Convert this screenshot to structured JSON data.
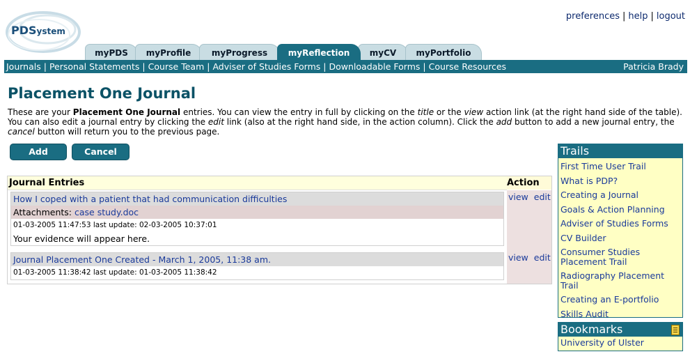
{
  "logo": {
    "text_part1": "PDS",
    "text_part2": "ystem"
  },
  "top_links": {
    "preferences": "preferences",
    "help": "help",
    "logout": "logout",
    "separator": "|"
  },
  "tabs": [
    {
      "label": "myPDS"
    },
    {
      "label": "myProfile"
    },
    {
      "label": "myProgress"
    },
    {
      "label": "myReflection"
    },
    {
      "label": "myCV"
    },
    {
      "label": "myPortfolio"
    }
  ],
  "navbar": {
    "items": [
      "Journals",
      "Personal Statements",
      "Course Team",
      "Adviser of Studies Forms",
      "Downloadable Forms",
      "Course Resources"
    ],
    "separator": "|",
    "user": "Patricia Brady"
  },
  "page": {
    "title": "Placement One Journal",
    "intro_1": "These are your ",
    "intro_bold": "Placement One Journal",
    "intro_2": " entries. You can view the entry in full by clicking on the ",
    "intro_title": "title",
    "intro_3": " or the ",
    "intro_view": "view",
    "intro_4": " action link (at the right hand side of the table). You can also edit a journal entry by clicking the ",
    "intro_edit": "edit",
    "intro_5": " link (also at the right hand side, in the action column). Click the ",
    "intro_add": "add",
    "intro_6": " button to add a new journal entry, the ",
    "intro_cancel": "cancel",
    "intro_7": " button will return you to the previous page."
  },
  "buttons": {
    "add": "Add",
    "cancel": "Cancel"
  },
  "entries": {
    "header": "Journal Entries",
    "action_header": "Action",
    "view_label": "view",
    "edit_label": "edit",
    "items": [
      {
        "title": "How I coped with a patient that had communication difficulties",
        "attachments_label": "Attachments:",
        "attachment": "case study.doc",
        "meta": "01-03-2005 11:47:53 last update: 02-03-2005 10:37:01",
        "evidence": "Your evidence will appear here."
      },
      {
        "title": "Journal Placement One Created - March 1, 2005, 11:38 am.",
        "meta": "01-03-2005 11:38:42 last update: 01-03-2005 11:38:42"
      }
    ]
  },
  "trails": {
    "title": "Trails",
    "items": [
      "First Time User Trail",
      "What is PDP?",
      "Creating a Journal",
      "Goals & Action Planning",
      "Adviser of Studies Forms",
      "CV Builder",
      "Consumer Studies Placement Trail",
      "Radiography Placement Trail",
      "Creating an E-portfolio",
      "Skills Audit"
    ]
  },
  "bookmarks": {
    "title": "Bookmarks",
    "icon": "bookmark-icon",
    "items": [
      "University of Ulster"
    ]
  }
}
